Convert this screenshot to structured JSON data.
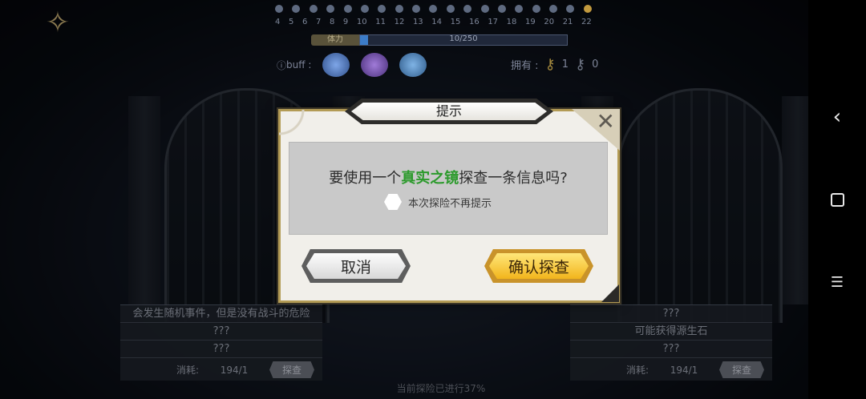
{
  "stage": {
    "numbers": [
      "4",
      "5",
      "6",
      "7",
      "8",
      "9",
      "10",
      "11",
      "12",
      "13",
      "14",
      "15",
      "16",
      "17",
      "18",
      "19",
      "20",
      "21",
      "22"
    ],
    "current_stage": "22",
    "track_label": "体力",
    "track_value": "10/250",
    "track_fill_fraction": 0.04
  },
  "buff": {
    "label": "buff :"
  },
  "inventory": {
    "label": "拥有 :",
    "gold_key_count": "1",
    "silver_key_count": "0"
  },
  "cards": {
    "left": {
      "lines": [
        "会发生随机事件，但是没有战斗的危险",
        "???",
        "???"
      ],
      "cost_label": "消耗:",
      "cost_value": "194/1",
      "button": "探查"
    },
    "right": {
      "lines": [
        "???",
        "可能获得源生石",
        "???"
      ],
      "cost_label": "消耗:",
      "cost_value": "194/1",
      "button": "探查"
    }
  },
  "bottom_note": "当前探险已进行37%",
  "dialog": {
    "title": "提示",
    "message_prefix": "要使用一个",
    "message_item": "真实之镜",
    "message_suffix": "探查一条信息吗?",
    "checkbox_label": "本次探险不再提示",
    "cancel_label": "取消",
    "confirm_label": "确认探查",
    "close_symbol": "✕"
  },
  "navbar": {
    "back_symbol": "‹",
    "menu_symbol": "☰"
  },
  "colors": {
    "accent_gold": "#b39b55",
    "item_green": "#2c9a2c",
    "confirm_yellow": "#f2b51c"
  }
}
